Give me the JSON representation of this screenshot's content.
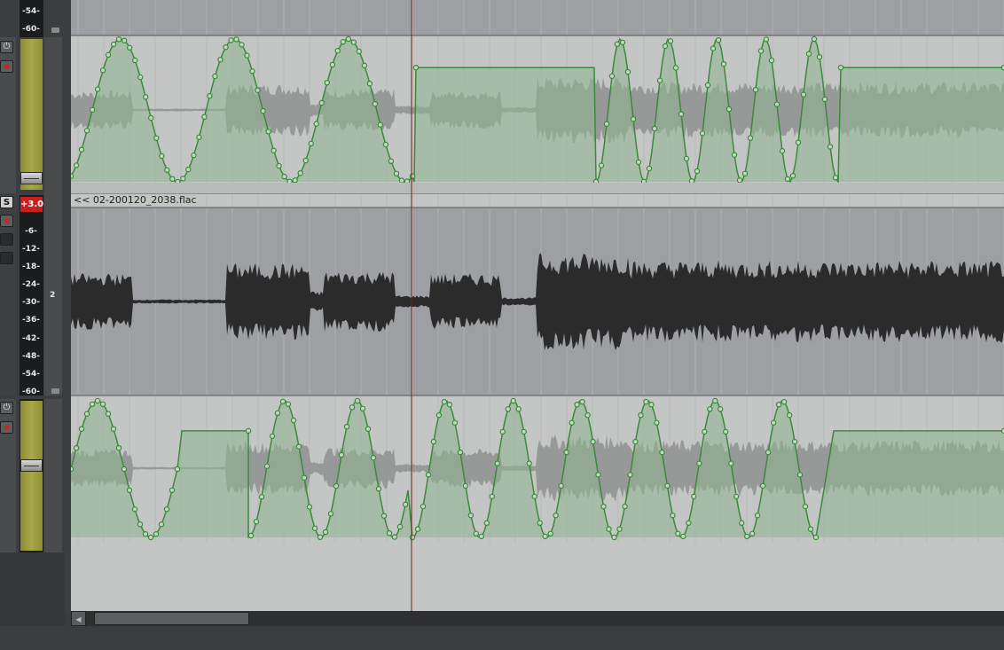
{
  "track1": {
    "scale_top": [
      "-54-",
      "-60-"
    ]
  },
  "track2": {
    "gain_badge": "+3.0",
    "solo_label": "S",
    "channel_number": "2",
    "item_label": "<< 02-200120_2038.flac",
    "scale": [
      "-6-",
      "-12-",
      "-18-",
      "-24-",
      "-30-",
      "-36-",
      "-42-",
      "-48-",
      "-54-",
      "-60-"
    ]
  },
  "icons": [
    "power-icon",
    "record-arm-icon",
    "folder-icon",
    "scroll-left-arrow-icon"
  ],
  "colors": {
    "envelope": "#3a8a3a",
    "envelope_fill": "#8fb48f",
    "waveform_bg": "#9d9fa3",
    "waveform": "#2b2b2b",
    "playhead": "#7a1f1f",
    "gain_badge": "#c8201e",
    "fader": "#a6a84a"
  }
}
